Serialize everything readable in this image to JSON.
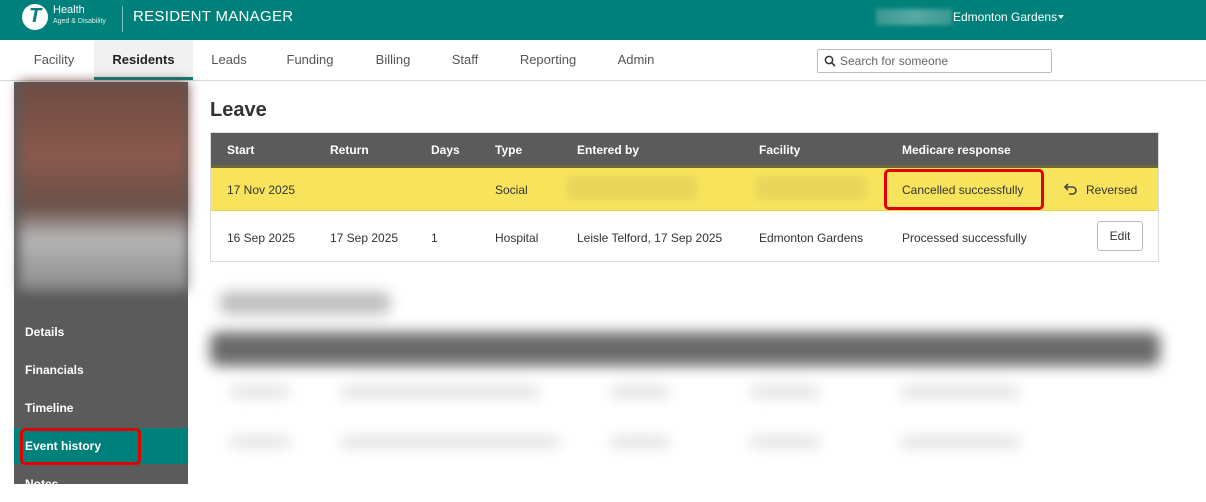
{
  "header": {
    "logo_name": "Health",
    "logo_subtitle": "Aged & Disability",
    "app_title": "RESIDENT MANAGER",
    "facility": "Edmonton Gardens"
  },
  "nav": {
    "tabs": [
      {
        "label": "Facility"
      },
      {
        "label": "Residents",
        "active": true
      },
      {
        "label": "Leads"
      },
      {
        "label": "Funding"
      },
      {
        "label": "Billing"
      },
      {
        "label": "Staff"
      },
      {
        "label": "Reporting"
      },
      {
        "label": "Admin"
      }
    ],
    "search_placeholder": "Search for someone"
  },
  "sidebar": {
    "items": [
      {
        "label": "Details"
      },
      {
        "label": "Financials"
      },
      {
        "label": "Timeline"
      },
      {
        "label": "Event history",
        "active": true
      },
      {
        "label": "Notes"
      }
    ]
  },
  "leave": {
    "title": "Leave",
    "columns": [
      "Start",
      "Return",
      "Days",
      "Type",
      "Entered by",
      "Facility",
      "Medicare response"
    ],
    "rows": [
      {
        "start": "17 Nov 2025",
        "return": "",
        "days": "",
        "type": "Social",
        "entered_by": "",
        "facility": "",
        "medicare_response": "Cancelled successfully",
        "action": "Reversed"
      },
      {
        "start": "16 Sep 2025",
        "return": "17 Sep 2025",
        "days": "1",
        "type": "Hospital",
        "entered_by": "Leisle Telford, 17 Sep 2025",
        "facility": "Edmonton Gardens",
        "medicare_response": "Processed successfully",
        "action": "Edit"
      }
    ]
  },
  "colors": {
    "brand": "#00807a",
    "highlight_row": "#f8e45c",
    "annotation": "#e00000",
    "table_header": "#5b5b5b"
  }
}
